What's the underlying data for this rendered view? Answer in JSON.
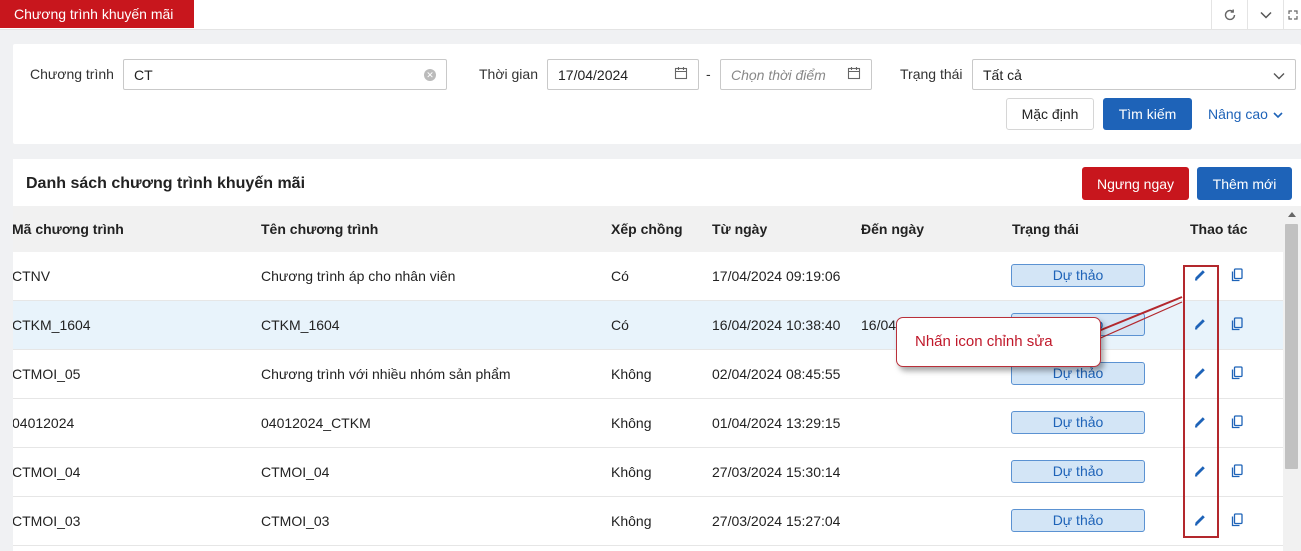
{
  "topbar": {
    "active_tab": "Chương trình khuyến mãi",
    "icons": [
      "refresh-icon",
      "chevron-down-icon",
      "expand-icon"
    ]
  },
  "filters": {
    "program_label": "Chương trình",
    "program_value": "CT",
    "time_label": "Thời gian",
    "date_from": "17/04/2024",
    "date_separator": "-",
    "date_to_placeholder": "Chọn thời điểm",
    "status_label": "Trạng thái",
    "status_value": "Tất cả",
    "default_button": "Mặc định",
    "search_button": "Tìm kiếm",
    "advanced_link": "Nâng cao"
  },
  "list": {
    "title": "Danh sách chương trình khuyến mãi",
    "stop_button": "Ngưng ngay",
    "add_button": "Thêm mới",
    "columns": [
      "Mã chương trình",
      "Tên chương trình",
      "Xếp chồng",
      "Từ ngày",
      "Đến ngày",
      "Trạng thái",
      "Thao tác"
    ],
    "rows": [
      {
        "code": "CTNV",
        "name": "Chương trình áp cho nhân viên",
        "stack": "Có",
        "from": "17/04/2024 09:19:06",
        "to": "",
        "status": "Dự thảo"
      },
      {
        "code": "CTKM_1604",
        "name": "CTKM_1604",
        "stack": "Có",
        "from": "16/04/2024 10:38:40",
        "to": "16/04",
        "status": "Dự thảo"
      },
      {
        "code": "CTMOI_05",
        "name": "Chương trình với nhiều nhóm sản phẩm",
        "stack": "Không",
        "from": "02/04/2024 08:45:55",
        "to": "",
        "status": "Dự thảo"
      },
      {
        "code": "04012024",
        "name": "04012024_CTKM",
        "stack": "Không",
        "from": "01/04/2024 13:29:15",
        "to": "",
        "status": "Dự thảo"
      },
      {
        "code": "CTMOI_04",
        "name": "CTMOI_04",
        "stack": "Không",
        "from": "27/03/2024 15:30:14",
        "to": "",
        "status": "Dự thảo"
      },
      {
        "code": "CTMOI_03",
        "name": "CTMOI_03",
        "stack": "Không",
        "from": "27/03/2024 15:27:04",
        "to": "",
        "status": "Dự thảo"
      }
    ]
  },
  "annotation": {
    "callout_text": "Nhấn icon chỉnh sửa"
  },
  "colors": {
    "brand_red": "#c8161d",
    "primary_blue": "#1e63b8",
    "status_fill": "#d3e5f6",
    "highlight_row": "#e8f3fb"
  }
}
